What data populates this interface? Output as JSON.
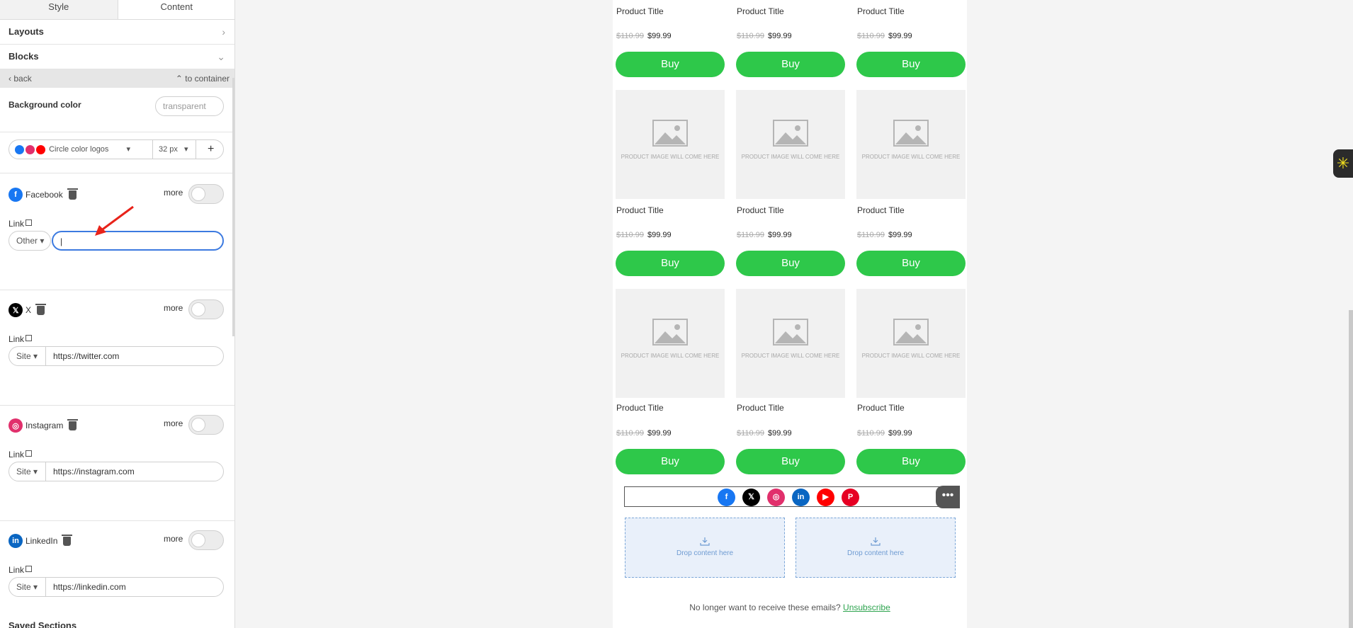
{
  "tabs": {
    "style": "Style",
    "content": "Content"
  },
  "accordion": {
    "layouts": "Layouts",
    "blocks": "Blocks",
    "saved_sections": "Saved Sections"
  },
  "nav": {
    "back": "back",
    "to_container": "to container"
  },
  "background": {
    "label": "Background color",
    "value": "transparent"
  },
  "logos": {
    "style_label": "Circle color logos",
    "size": "32 px",
    "add": "+"
  },
  "socials": [
    {
      "name": "Facebook",
      "more": "more",
      "link_label": "Link",
      "type": "Other",
      "url": "",
      "color": "#1877f2",
      "icon": "facebook-icon"
    },
    {
      "name": "X",
      "more": "more",
      "link_label": "Link",
      "type": "Site",
      "url": "https://twitter.com",
      "color": "#000000",
      "icon": "x-icon"
    },
    {
      "name": "Instagram",
      "more": "more",
      "link_label": "Link",
      "type": "Site",
      "url": "https://instagram.com",
      "color": "#e1306c",
      "icon": "instagram-icon"
    },
    {
      "name": "LinkedIn",
      "more": "more",
      "link_label": "Link",
      "type": "Site",
      "url": "https://linkedin.com",
      "color": "#0a66c2",
      "icon": "linkedin-icon"
    }
  ],
  "products": {
    "title": "Product Title",
    "old_price": "$110.99",
    "new_price": "$99.99",
    "buy": "Buy",
    "image_text": "PRODUCT IMAGE WILL COME HERE"
  },
  "footer_social_icons": [
    {
      "name": "facebook-icon",
      "color": "#1877f2",
      "glyph": "f"
    },
    {
      "name": "x-icon",
      "color": "#000000",
      "glyph": "𝕏"
    },
    {
      "name": "instagram-icon",
      "color": "#e1306c",
      "glyph": "◎"
    },
    {
      "name": "linkedin-icon",
      "color": "#0a66c2",
      "glyph": "in"
    },
    {
      "name": "youtube-icon",
      "color": "#ff0000",
      "glyph": "▶"
    },
    {
      "name": "pinterest-icon",
      "color": "#e60023",
      "glyph": "P"
    }
  ],
  "more_menu": "•••",
  "drop_zone": "Drop content here",
  "unsubscribe": {
    "text": "No longer want to receive these emails?",
    "link": "Unsubscribe"
  },
  "colors": {
    "buy_button": "#2ec84a",
    "accent_link": "#2ea44f",
    "focus": "#3c7ae0"
  }
}
